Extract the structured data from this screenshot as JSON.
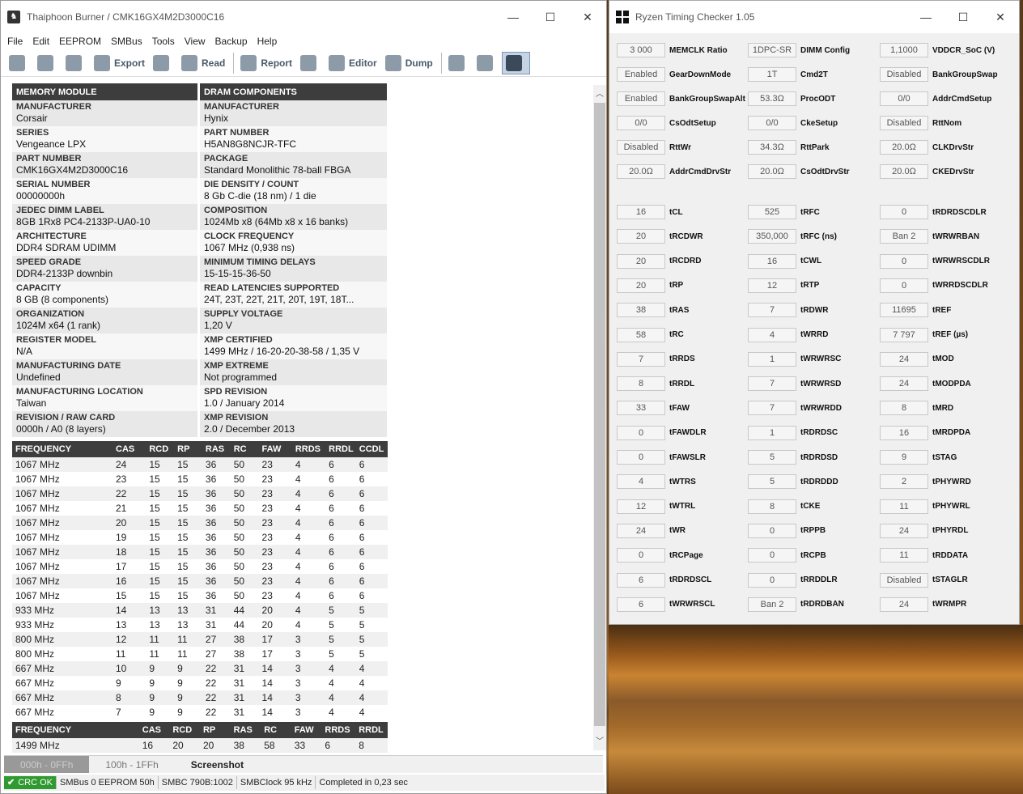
{
  "thaiphoon": {
    "title": "Thaiphoon Burner / CMK16GX4M2D3000C16",
    "menu": [
      "File",
      "Edit",
      "EEPROM",
      "SMBus",
      "Tools",
      "View",
      "Backup",
      "Help"
    ],
    "toolbar": {
      "export": "Export",
      "read": "Read",
      "report": "Report",
      "editor": "Editor",
      "dump": "Dump"
    },
    "headers": {
      "left": "MEMORY MODULE",
      "right": "DRAM COMPONENTS"
    },
    "rows": [
      {
        "l_label": "MANUFACTURER",
        "l_value": "Corsair",
        "r_label": "MANUFACTURER",
        "r_value": "Hynix"
      },
      {
        "l_label": "SERIES",
        "l_value": "Vengeance LPX",
        "r_label": "PART NUMBER",
        "r_value": "H5AN8G8NCJR-TFC"
      },
      {
        "l_label": "PART NUMBER",
        "l_value": "CMK16GX4M2D3000C16",
        "r_label": "PACKAGE",
        "r_value": "Standard Monolithic 78-ball FBGA"
      },
      {
        "l_label": "SERIAL NUMBER",
        "l_value": "00000000h",
        "r_label": "DIE DENSITY / COUNT",
        "r_value": "8 Gb C-die (18 nm) / 1 die"
      },
      {
        "l_label": "JEDEC DIMM LABEL",
        "l_value": "8GB 1Rx8 PC4-2133P-UA0-10",
        "r_label": "COMPOSITION",
        "r_value": "1024Mb x8 (64Mb x8 x 16 banks)"
      },
      {
        "l_label": "ARCHITECTURE",
        "l_value": "DDR4 SDRAM UDIMM",
        "r_label": "CLOCK FREQUENCY",
        "r_value": "1067 MHz (0,938 ns)"
      },
      {
        "l_label": "SPEED GRADE",
        "l_value": "DDR4-2133P downbin",
        "r_label": "MINIMUM TIMING DELAYS",
        "r_value": "15-15-15-36-50"
      },
      {
        "l_label": "CAPACITY",
        "l_value": "8 GB (8 components)",
        "r_label": "READ LATENCIES SUPPORTED",
        "r_value": "24T, 23T, 22T, 21T, 20T, 19T, 18T..."
      },
      {
        "l_label": "ORGANIZATION",
        "l_value": "1024M x64 (1 rank)",
        "r_label": "SUPPLY VOLTAGE",
        "r_value": "1,20 V"
      },
      {
        "l_label": "REGISTER MODEL",
        "l_value": "N/A",
        "r_label": "XMP CERTIFIED",
        "r_value": "1499 MHz / 16-20-20-38-58 / 1,35 V"
      },
      {
        "l_label": "MANUFACTURING DATE",
        "l_value": "Undefined",
        "r_label": "XMP EXTREME",
        "r_value": "Not programmed"
      },
      {
        "l_label": "MANUFACTURING LOCATION",
        "l_value": "Taiwan",
        "r_label": "SPD REVISION",
        "r_value": "1.0 / January 2014"
      },
      {
        "l_label": "REVISION / RAW CARD",
        "l_value": "0000h / A0 (8 layers)",
        "r_label": "XMP REVISION",
        "r_value": "2.0 / December 2013"
      }
    ],
    "freq_headers": [
      "FREQUENCY",
      "CAS",
      "RCD",
      "RP",
      "RAS",
      "RC",
      "FAW",
      "RRDS",
      "RRDL",
      "CCDL"
    ],
    "freq_rows": [
      [
        "1067 MHz",
        "24",
        "15",
        "15",
        "36",
        "50",
        "23",
        "4",
        "6",
        "6"
      ],
      [
        "1067 MHz",
        "23",
        "15",
        "15",
        "36",
        "50",
        "23",
        "4",
        "6",
        "6"
      ],
      [
        "1067 MHz",
        "22",
        "15",
        "15",
        "36",
        "50",
        "23",
        "4",
        "6",
        "6"
      ],
      [
        "1067 MHz",
        "21",
        "15",
        "15",
        "36",
        "50",
        "23",
        "4",
        "6",
        "6"
      ],
      [
        "1067 MHz",
        "20",
        "15",
        "15",
        "36",
        "50",
        "23",
        "4",
        "6",
        "6"
      ],
      [
        "1067 MHz",
        "19",
        "15",
        "15",
        "36",
        "50",
        "23",
        "4",
        "6",
        "6"
      ],
      [
        "1067 MHz",
        "18",
        "15",
        "15",
        "36",
        "50",
        "23",
        "4",
        "6",
        "6"
      ],
      [
        "1067 MHz",
        "17",
        "15",
        "15",
        "36",
        "50",
        "23",
        "4",
        "6",
        "6"
      ],
      [
        "1067 MHz",
        "16",
        "15",
        "15",
        "36",
        "50",
        "23",
        "4",
        "6",
        "6"
      ],
      [
        "1067 MHz",
        "15",
        "15",
        "15",
        "36",
        "50",
        "23",
        "4",
        "6",
        "6"
      ],
      [
        "933 MHz",
        "14",
        "13",
        "13",
        "31",
        "44",
        "20",
        "4",
        "5",
        "5"
      ],
      [
        "933 MHz",
        "13",
        "13",
        "13",
        "31",
        "44",
        "20",
        "4",
        "5",
        "5"
      ],
      [
        "800 MHz",
        "12",
        "11",
        "11",
        "27",
        "38",
        "17",
        "3",
        "5",
        "5"
      ],
      [
        "800 MHz",
        "11",
        "11",
        "11",
        "27",
        "38",
        "17",
        "3",
        "5",
        "5"
      ],
      [
        "667 MHz",
        "10",
        "9",
        "9",
        "22",
        "31",
        "14",
        "3",
        "4",
        "4"
      ],
      [
        "667 MHz",
        "9",
        "9",
        "9",
        "22",
        "31",
        "14",
        "3",
        "4",
        "4"
      ],
      [
        "667 MHz",
        "8",
        "9",
        "9",
        "22",
        "31",
        "14",
        "3",
        "4",
        "4"
      ],
      [
        "667 MHz",
        "7",
        "9",
        "9",
        "22",
        "31",
        "14",
        "3",
        "4",
        "4"
      ]
    ],
    "xmp_headers": [
      "FREQUENCY",
      "CAS",
      "RCD",
      "RP",
      "RAS",
      "RC",
      "FAW",
      "RRDS",
      "RRDL"
    ],
    "xmp_row": [
      "1499 MHz",
      "16",
      "20",
      "20",
      "38",
      "58",
      "33",
      "6",
      "8"
    ],
    "tabs": [
      "000h - 0FFh",
      "100h - 1FFh",
      "Screenshot"
    ],
    "status": [
      "CRC OK",
      "SMBus 0 EEPROM 50h",
      "SMBC 790B:1002",
      "SMBClock 95 kHz",
      "Completed in 0,23 sec"
    ]
  },
  "ryzen": {
    "title": "Ryzen Timing Checker 1.05",
    "col1": [
      [
        "3 000",
        "MEMCLK Ratio"
      ],
      [
        "Enabled",
        "GearDownMode"
      ],
      [
        "Enabled",
        "BankGroupSwapAlt"
      ],
      [
        "0/0",
        "CsOdtSetup"
      ],
      [
        "Disabled",
        "RttWr"
      ],
      [
        "20.0Ω",
        "AddrCmdDrvStr"
      ],
      null,
      [
        "16",
        "tCL"
      ],
      [
        "20",
        "tRCDWR"
      ],
      [
        "20",
        "tRCDRD"
      ],
      [
        "20",
        "tRP"
      ],
      [
        "38",
        "tRAS"
      ],
      [
        "58",
        "tRC"
      ],
      [
        "7",
        "tRRDS"
      ],
      [
        "8",
        "tRRDL"
      ],
      [
        "33",
        "tFAW"
      ],
      [
        "0",
        "tFAWDLR"
      ],
      [
        "0",
        "tFAWSLR"
      ],
      [
        "4",
        "tWTRS"
      ],
      [
        "12",
        "tWTRL"
      ],
      [
        "24",
        "tWR"
      ],
      [
        "0",
        "tRCPage"
      ],
      [
        "6",
        "tRDRDSCL"
      ],
      [
        "6",
        "tWRWRSCL"
      ]
    ],
    "col2": [
      [
        "1DPC-SR",
        "DIMM Config"
      ],
      [
        "1T",
        "Cmd2T"
      ],
      [
        "53.3Ω",
        "ProcODT"
      ],
      [
        "0/0",
        "CkeSetup"
      ],
      [
        "34.3Ω",
        "RttPark"
      ],
      [
        "20.0Ω",
        "CsOdtDrvStr"
      ],
      null,
      [
        "525",
        "tRFC"
      ],
      [
        "350,000",
        "tRFC (ns)"
      ],
      [
        "16",
        "tCWL"
      ],
      [
        "12",
        "tRTP"
      ],
      [
        "7",
        "tRDWR"
      ],
      [
        "4",
        "tWRRD"
      ],
      [
        "1",
        "tWRWRSC"
      ],
      [
        "7",
        "tWRWRSD"
      ],
      [
        "7",
        "tWRWRDD"
      ],
      [
        "1",
        "tRDRDSC"
      ],
      [
        "5",
        "tRDRDSD"
      ],
      [
        "5",
        "tRDRDDD"
      ],
      [
        "8",
        "tCKE"
      ],
      [
        "0",
        "tRPPB"
      ],
      [
        "0",
        "tRCPB"
      ],
      [
        "0",
        "tRRDDLR"
      ],
      [
        "Ban 2",
        "tRDRDBAN"
      ]
    ],
    "col3": [
      [
        "1,1000",
        "VDDCR_SoC (V)"
      ],
      [
        "Disabled",
        "BankGroupSwap"
      ],
      [
        "0/0",
        "AddrCmdSetup"
      ],
      [
        "Disabled",
        "RttNom"
      ],
      [
        "20.0Ω",
        "CLKDrvStr"
      ],
      [
        "20.0Ω",
        "CKEDrvStr"
      ],
      null,
      [
        "0",
        "tRDRDSCDLR"
      ],
      [
        "Ban 2",
        "tWRWRBAN"
      ],
      [
        "0",
        "tWRWRSCDLR"
      ],
      [
        "0",
        "tWRRDSCDLR"
      ],
      [
        "11695",
        "tREF"
      ],
      [
        "7 797",
        "tREF (µs)"
      ],
      [
        "24",
        "tMOD"
      ],
      [
        "24",
        "tMODPDA"
      ],
      [
        "8",
        "tMRD"
      ],
      [
        "16",
        "tMRDPDA"
      ],
      [
        "9",
        "tSTAG"
      ],
      [
        "2",
        "tPHYWRD"
      ],
      [
        "11",
        "tPHYWRL"
      ],
      [
        "24",
        "tPHYRDL"
      ],
      [
        "11",
        "tRDDATA"
      ],
      [
        "Disabled",
        "tSTAGLR"
      ],
      [
        "24",
        "tWRMPR"
      ]
    ]
  }
}
